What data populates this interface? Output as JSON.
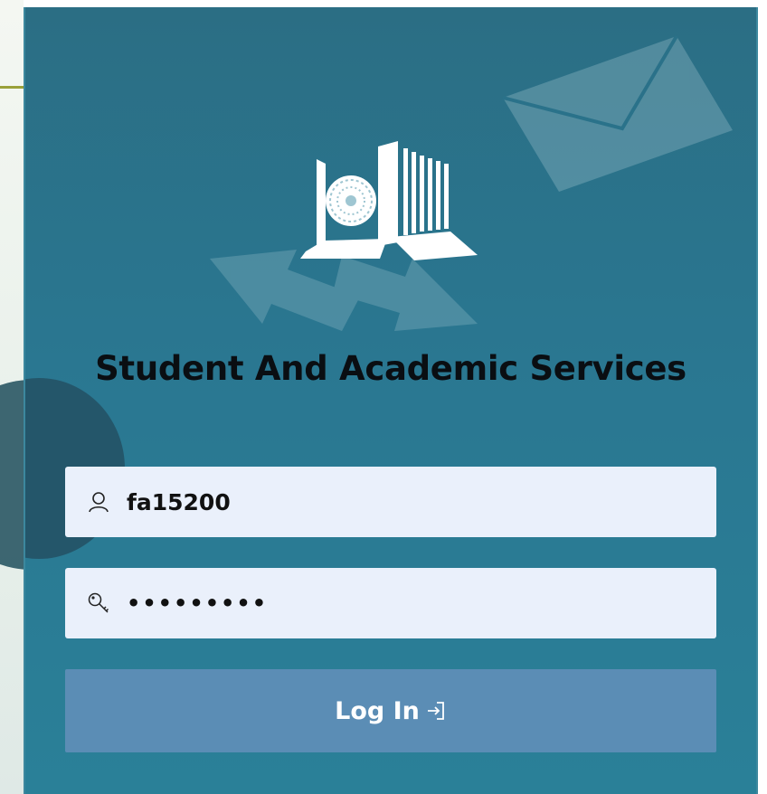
{
  "app": {
    "title": "Student And Academic Services"
  },
  "login_form": {
    "username": {
      "value": "fa15200",
      "icon": "user-icon"
    },
    "password": {
      "value": "•••••••••",
      "icon": "key-icon"
    },
    "submit": {
      "label": "Log In",
      "icon": "login-arrow-icon"
    }
  },
  "colors": {
    "panel": "#2a7791",
    "button": "#5b8db5",
    "field": "#eaf0fb",
    "title": "#0a0e12"
  },
  "decorations": {
    "logo": "university-building-logo",
    "background_icons": [
      "envelope-icon",
      "arrows-icon"
    ]
  }
}
